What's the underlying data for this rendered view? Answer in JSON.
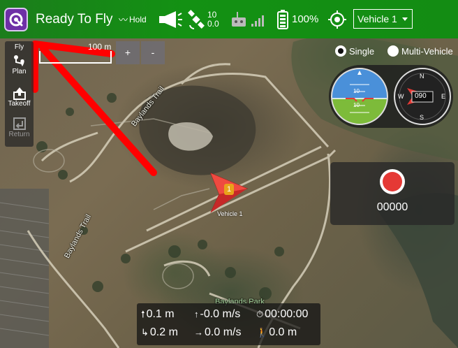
{
  "toolbar": {
    "flight_status": "Ready To Fly",
    "flight_mode": "Hold",
    "satellite_count": "10",
    "hdop": "0.0",
    "battery": "100%",
    "vehicle_selector": "Vehicle 1"
  },
  "tools": {
    "fly": "Fly",
    "plan": "Plan",
    "takeoff": "Takeoff",
    "return": "Return"
  },
  "map": {
    "scale_label": "100 m",
    "zoom_in": "+",
    "zoom_out": "-",
    "trail_label_1": "Baylands Trail",
    "trail_label_2": "Baylands Trail",
    "park_label": "Baylands Park",
    "vehicle_label": "Vehicle 1",
    "vehicle_marker_text": "1"
  },
  "view_mode": {
    "single": "Single",
    "multi": "Multi-Vehicle",
    "selected": "single"
  },
  "instruments": {
    "heading": "090",
    "compass_n": "N",
    "compass_e": "E",
    "compass_s": "S",
    "compass_w": "W",
    "pitch_upper": "10",
    "pitch_lower": "10"
  },
  "camera": {
    "video_time": "00000"
  },
  "telemetry": {
    "altitude_relative": "0.1 m",
    "vertical_speed": "-0.0 m/s",
    "flight_time": "00:00:00",
    "distance_home": "0.2 m",
    "ground_speed": "0.0 m/s",
    "distance_gcs": "0.0 m"
  },
  "colors": {
    "toolbar_green": "#139113",
    "logo_purple": "#6e2fa6",
    "annotation_red": "#ff0000",
    "record_red": "#e53935",
    "vehicle_red": "#e53030"
  }
}
